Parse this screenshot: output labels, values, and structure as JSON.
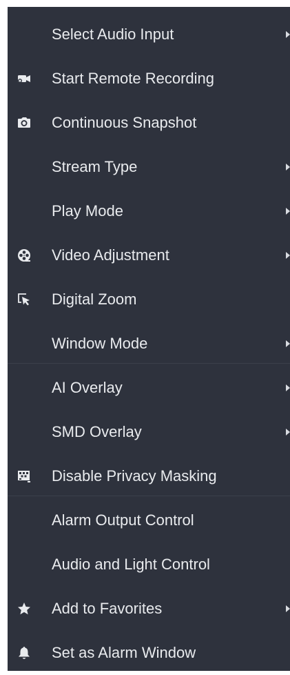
{
  "menu": {
    "items": [
      {
        "label": "Select Audio Input"
      },
      {
        "label": "Start Remote Recording",
        "icon": "video-camera-icon"
      },
      {
        "label": "Continuous Snapshot",
        "icon": "camera-icon"
      },
      {
        "label": "Stream Type"
      },
      {
        "label": "Play Mode"
      },
      {
        "label": "Video Adjustment",
        "icon": "film-reel-icon"
      },
      {
        "label": "Digital Zoom",
        "icon": "zoom-cursor-icon"
      },
      {
        "label": "Window Mode"
      },
      {
        "label": "AI Overlay"
      },
      {
        "label": "SMD Overlay"
      },
      {
        "label": "Disable Privacy Masking",
        "icon": "privacy-mask-icon"
      },
      {
        "label": "Alarm Output Control"
      },
      {
        "label": "Audio and Light Control"
      },
      {
        "label": "Add to Favorites",
        "icon": "star-icon"
      },
      {
        "label": "Set as Alarm Window",
        "icon": "bell-icon"
      }
    ]
  },
  "colors": {
    "background": "#2e323d",
    "text": "#e9ebee",
    "icon": "#e9ebee",
    "separator": "#3b404b"
  }
}
